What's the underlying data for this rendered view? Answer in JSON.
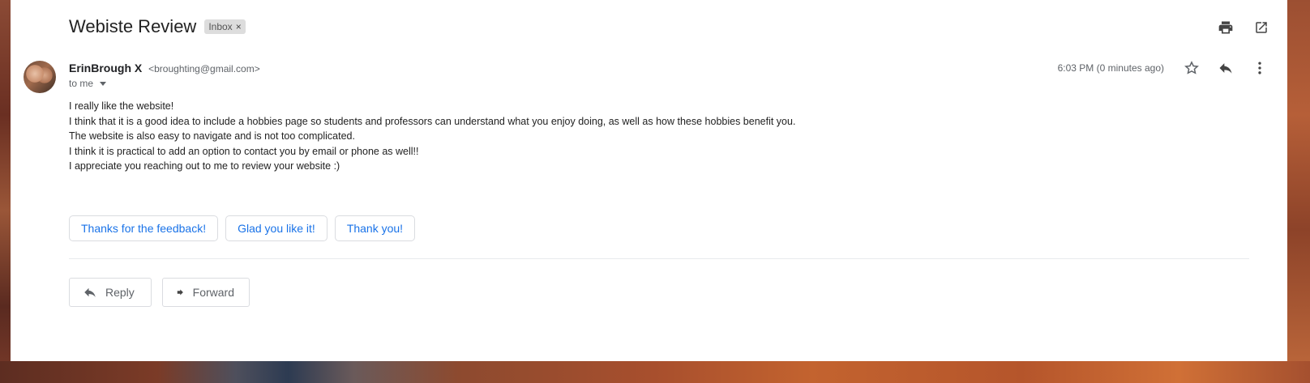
{
  "email": {
    "subject": "Webiste Review",
    "label_chip": "Inbox",
    "label_remove": "×",
    "sender_name": "ErinBrough X",
    "sender_email": "<broughting@gmail.com>",
    "recipient": "to me",
    "timestamp": "6:03 PM (0 minutes ago)",
    "body_lines": [
      "I really like the website!",
      "I think that it is a good idea to include a hobbies page so students and professors can understand what you enjoy doing, as well as how these hobbies benefit you.",
      "The website is also easy to navigate and is not too complicated.",
      "I think it is practical to add an option to contact you by email or phone as well!!",
      "I appreciate you reaching out to me to review your website :)"
    ]
  },
  "smart_replies": [
    "Thanks for the feedback!",
    "Glad you like it!",
    "Thank you!"
  ],
  "actions": {
    "reply": "Reply",
    "forward": "Forward"
  },
  "icons": {
    "print": "print-icon",
    "popout": "open-in-new-window-icon",
    "star": "star-icon",
    "reply": "reply-icon",
    "more": "more-vertical-icon",
    "forward": "forward-icon"
  },
  "colors": {
    "accent": "#1a73e8",
    "chip_bg": "#dddddd"
  }
}
